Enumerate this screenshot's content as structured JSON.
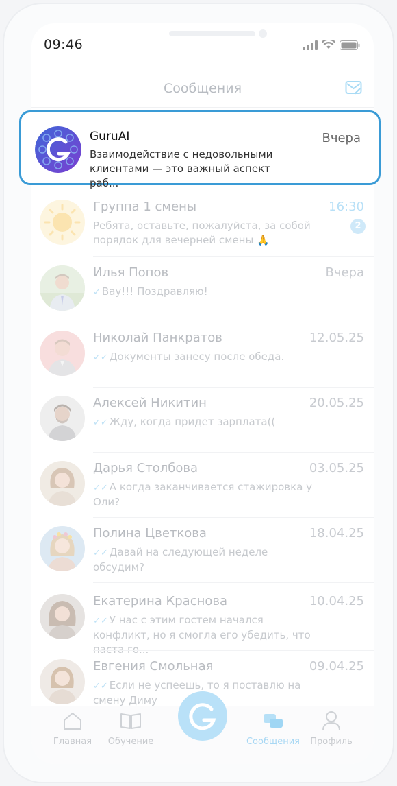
{
  "status": {
    "time": "09:46"
  },
  "header": {
    "title": "Сообщения"
  },
  "chats": [
    {
      "name": "GuruAI",
      "time": "Вчера",
      "preview": "Взаимодействие с недовольными клиентами — это важный аспект раб...",
      "avatar": "guru-ai-logo"
    },
    {
      "name": "Группа 1 смены",
      "time": "16:30",
      "preview": "Ребята, оставьте, пожалуйста, за собой порядок для вечерней смены 🙏",
      "badge": "2",
      "avatar": "sun-icon"
    },
    {
      "name": "Илья Попов",
      "time": "Вчера",
      "preview": "Вау!!! Поздравляю!",
      "avatar": "photo"
    },
    {
      "name": "Николай Панкратов",
      "time": "12.05.25",
      "preview": "Документы занесу после обеда.",
      "avatar": "photo"
    },
    {
      "name": "Алексей Никитин",
      "time": "20.05.25",
      "preview": "Жду, когда придет зарплата((",
      "avatar": "photo"
    },
    {
      "name": "Дарья Столбова",
      "time": "03.05.25",
      "preview": "А когда заканчивается стажировка у Оли?",
      "avatar": "photo"
    },
    {
      "name": "Полина Цветкова",
      "time": "18.04.25",
      "preview": "Давай на следующей неделе обсудим?",
      "avatar": "photo"
    },
    {
      "name": "Екатерина Краснова",
      "time": "10.04.25",
      "preview": "У нас с этим гостем начался конфликт, но я смогла его убедить, что паста го...",
      "avatar": "photo"
    },
    {
      "name": "Евгения Смольная",
      "time": "09.04.25",
      "preview": "Если не успеешь, то я поставлю на смену Диму",
      "avatar": "photo"
    }
  ],
  "tabs": [
    {
      "label": "Главная",
      "icon": "home-icon"
    },
    {
      "label": "Обучение",
      "icon": "book-icon"
    },
    {
      "label": "Сообщения",
      "icon": "chat-icon",
      "active": true
    },
    {
      "label": "Профиль",
      "icon": "profile-icon"
    }
  ],
  "colors": {
    "accent": "#3a9bd6",
    "highlight_border": "#3a9bd6"
  }
}
